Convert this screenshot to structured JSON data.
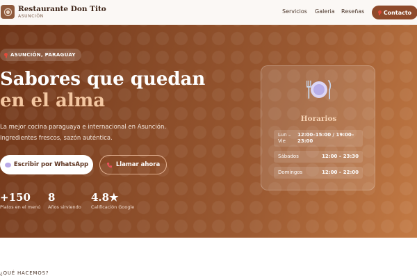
{
  "nav": {
    "brand_name": "Restaurante Don Tito",
    "brand_sub": "ASUNCIÓN",
    "links": [
      "Servicios",
      "Galeria",
      "Reseñas"
    ],
    "contact_label": "Contacto"
  },
  "hero": {
    "location": "ASUNCIÓN, PARAGUAY",
    "title_line1": "Sabores que quedan",
    "title_line2": "en el alma",
    "desc_line1": "La mejor cocina paraguaya e internacional en Asunción.",
    "desc_line2": "Ingredientes frescos, sazón auténtica.",
    "whatsapp_label": "Escribir por WhatsApp",
    "call_label": "Llamar ahora",
    "stats": [
      {
        "num": "+150",
        "label": "Platos en el menú"
      },
      {
        "num": "8",
        "label": "Años sirviendo"
      },
      {
        "num": "4.8★",
        "label": "Calificación Google"
      }
    ]
  },
  "hours": {
    "title": "Horarios",
    "rows": [
      {
        "day": "Lun – Vie",
        "hours": "12:00–15:00 / 19:00–23:00"
      },
      {
        "day": "Sábados",
        "hours": "12:00 – 23:30"
      },
      {
        "day": "Domingos",
        "hours": "12:00 – 22:00"
      }
    ]
  },
  "section": {
    "label": "¿QUÉ HACEMOS?"
  },
  "colors": {
    "accent": "#8e4a2b",
    "title_highlight": "#f4c7a1",
    "card_title": "#f6d3b4"
  },
  "icons": {
    "logo": "plate-icon",
    "pin": "map-pin-icon",
    "chat": "chat-bubble-icon",
    "phone": "phone-icon",
    "plate": "plate-cutlery-icon"
  }
}
